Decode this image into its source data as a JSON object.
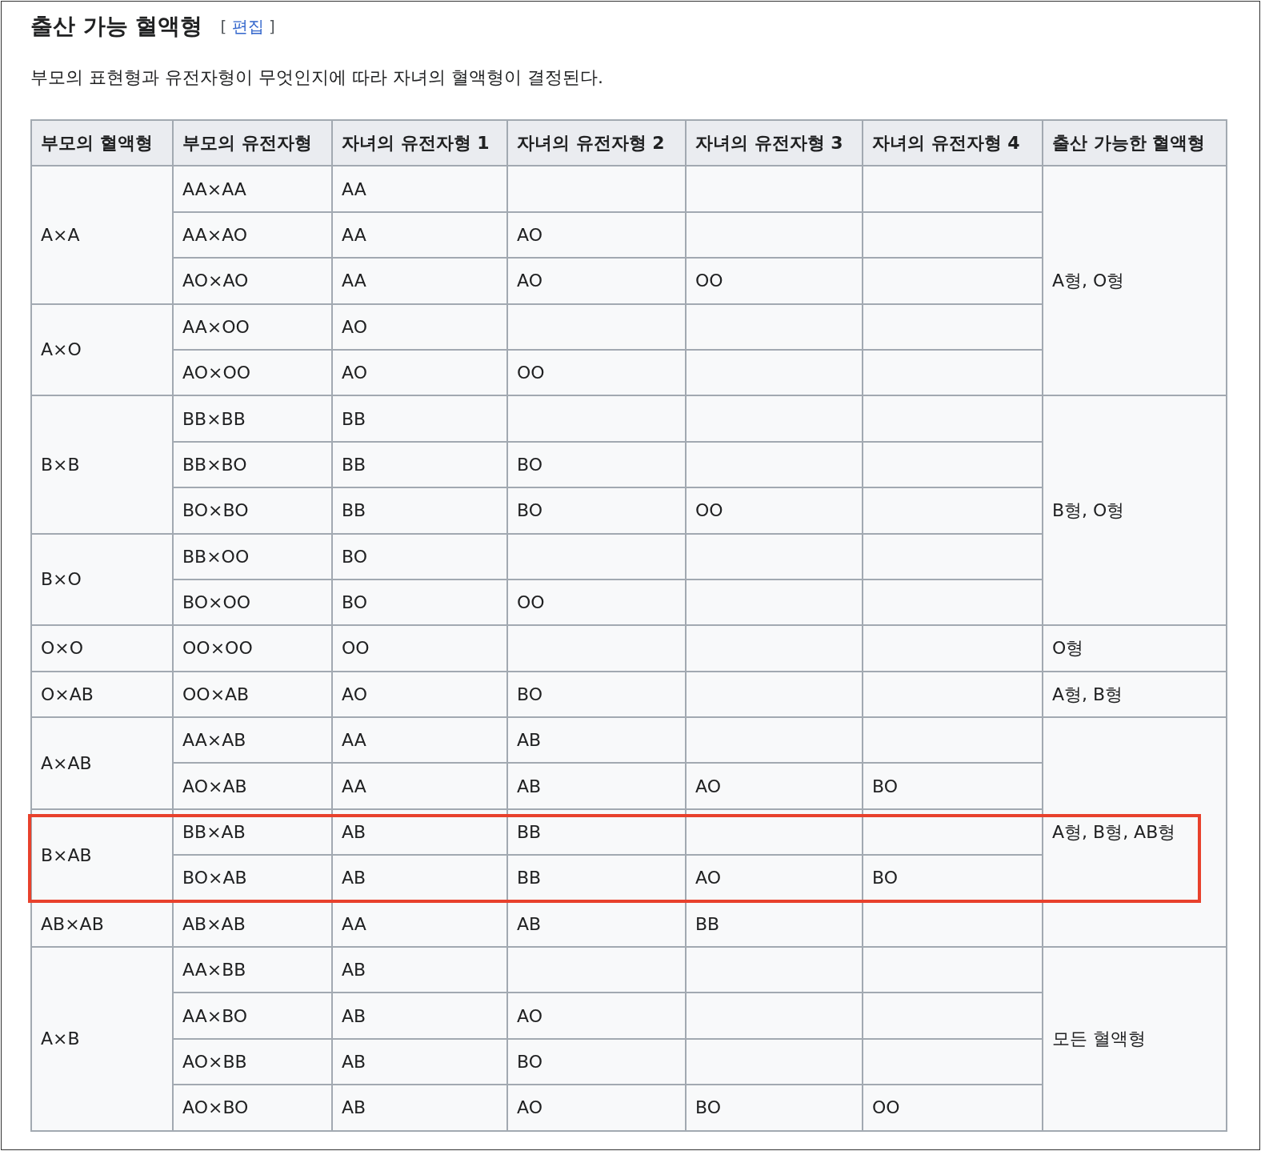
{
  "heading": {
    "title": "출산 가능 혈액형",
    "edit_link": "편집",
    "bracket_open": "[",
    "bracket_close": "]"
  },
  "intro": "부모의 표현형과 유전자형이 무엇인지에 따라 자녀의 혈액형이 결정된다.",
  "table": {
    "columns": [
      "부모의 혈액형",
      "부모의 유전자형",
      "자녀의 유전자형 1",
      "자녀의 유전자형 2",
      "자녀의 유전자형 3",
      "자녀의 유전자형 4",
      "출산 가능한 혈액형"
    ],
    "result_groups": [
      {
        "result": "A형, O형",
        "parents": [
          {
            "phenotype": "A×A",
            "highlighted": false,
            "genotypes": [
              {
                "genotype": "AA×AA",
                "children": [
                  "AA"
                ]
              },
              {
                "genotype": "AA×AO",
                "children": [
                  "AA",
                  "AO"
                ]
              },
              {
                "genotype": "AO×AO",
                "children": [
                  "AA",
                  "AO",
                  "OO"
                ]
              }
            ]
          },
          {
            "phenotype": "A×O",
            "highlighted": false,
            "genotypes": [
              {
                "genotype": "AA×OO",
                "children": [
                  "AO"
                ]
              },
              {
                "genotype": "AO×OO",
                "children": [
                  "AO",
                  "OO"
                ]
              }
            ]
          }
        ]
      },
      {
        "result": "B형, O형",
        "parents": [
          {
            "phenotype": "B×B",
            "highlighted": false,
            "genotypes": [
              {
                "genotype": "BB×BB",
                "children": [
                  "BB"
                ]
              },
              {
                "genotype": "BB×BO",
                "children": [
                  "BB",
                  "BO"
                ]
              },
              {
                "genotype": "BO×BO",
                "children": [
                  "BB",
                  "BO",
                  "OO"
                ]
              }
            ]
          },
          {
            "phenotype": "B×O",
            "highlighted": false,
            "genotypes": [
              {
                "genotype": "BB×OO",
                "children": [
                  "BO"
                ]
              },
              {
                "genotype": "BO×OO",
                "children": [
                  "BO",
                  "OO"
                ]
              }
            ]
          }
        ]
      },
      {
        "result": "O형",
        "parents": [
          {
            "phenotype": "O×O",
            "highlighted": false,
            "genotypes": [
              {
                "genotype": "OO×OO",
                "children": [
                  "OO"
                ]
              }
            ]
          }
        ]
      },
      {
        "result": "A형, B형",
        "parents": [
          {
            "phenotype": "O×AB",
            "highlighted": false,
            "genotypes": [
              {
                "genotype": "OO×AB",
                "children": [
                  "AO",
                  "BO"
                ]
              }
            ]
          }
        ]
      },
      {
        "result": "A형, B형, AB형",
        "parents": [
          {
            "phenotype": "A×AB",
            "highlighted": false,
            "genotypes": [
              {
                "genotype": "AA×AB",
                "children": [
                  "AA",
                  "AB"
                ]
              },
              {
                "genotype": "AO×AB",
                "children": [
                  "AA",
                  "AB",
                  "AO",
                  "BO"
                ]
              }
            ]
          },
          {
            "phenotype": "B×AB",
            "highlighted": true,
            "genotypes": [
              {
                "genotype": "BB×AB",
                "children": [
                  "AB",
                  "BB"
                ]
              },
              {
                "genotype": "BO×AB",
                "children": [
                  "AB",
                  "BB",
                  "AO",
                  "BO"
                ]
              }
            ]
          },
          {
            "phenotype": "AB×AB",
            "highlighted": false,
            "genotypes": [
              {
                "genotype": "AB×AB",
                "children": [
                  "AA",
                  "AB",
                  "BB"
                ]
              }
            ]
          }
        ]
      },
      {
        "result": "모든 혈액형",
        "parents": [
          {
            "phenotype": "A×B",
            "highlighted": false,
            "genotypes": [
              {
                "genotype": "AA×BB",
                "children": [
                  "AB"
                ]
              },
              {
                "genotype": "AA×BO",
                "children": [
                  "AB",
                  "AO"
                ]
              },
              {
                "genotype": "AO×BB",
                "children": [
                  "AB",
                  "BO"
                ]
              },
              {
                "genotype": "AO×BO",
                "children": [
                  "AB",
                  "AO",
                  "BO",
                  "OO"
                ]
              }
            ]
          }
        ]
      }
    ]
  }
}
